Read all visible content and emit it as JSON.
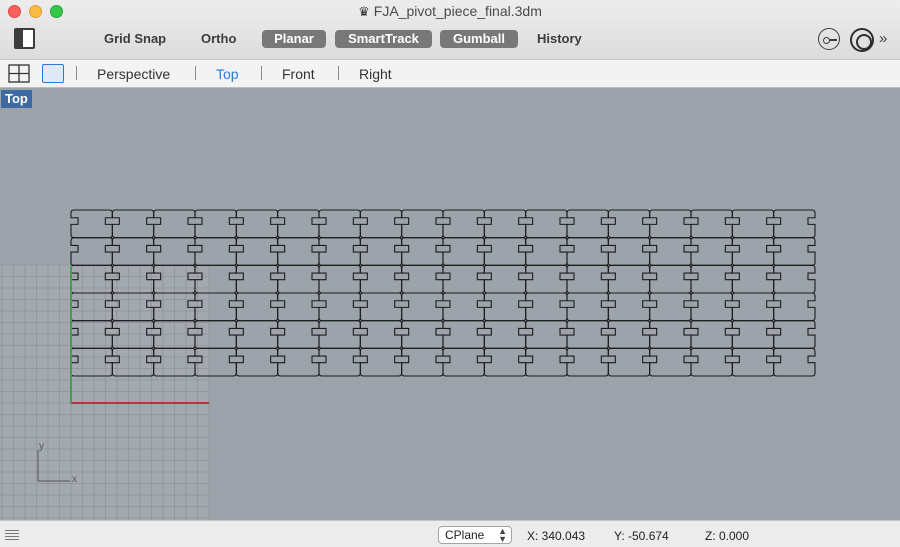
{
  "window": {
    "title": "FJA_pivot_piece_final.3dm",
    "doc_icon": "rhino-document-icon"
  },
  "toolbar": {
    "buttons": [
      {
        "label": "Grid Snap",
        "active": false
      },
      {
        "label": "Ortho",
        "active": false
      },
      {
        "label": "Planar",
        "active": true
      },
      {
        "label": "SmartTrack",
        "active": true
      },
      {
        "label": "Gumball",
        "active": true
      },
      {
        "label": "History",
        "active": false
      }
    ],
    "more_label": "»"
  },
  "viewbar": {
    "tabs": [
      {
        "label": "Perspective",
        "active": false
      },
      {
        "label": "Top",
        "active": true
      },
      {
        "label": "Front",
        "active": false
      },
      {
        "label": "Right",
        "active": false
      }
    ]
  },
  "viewport": {
    "label": "Top",
    "axis_x_label": "x",
    "axis_y_label": "y",
    "pattern": {
      "columns": 18,
      "rows": 6
    }
  },
  "status": {
    "cplane_label": "CPlane",
    "x": "X: 340.043",
    "y": "Y: -50.674",
    "z": "Z: 0.000"
  },
  "colors": {
    "viewport_bg": "#9ca3aa",
    "active_tab": "#2a7ad4",
    "label_bg": "#3d6aa3",
    "axis_x": "#b03a3a",
    "axis_y": "#3fa24a"
  }
}
